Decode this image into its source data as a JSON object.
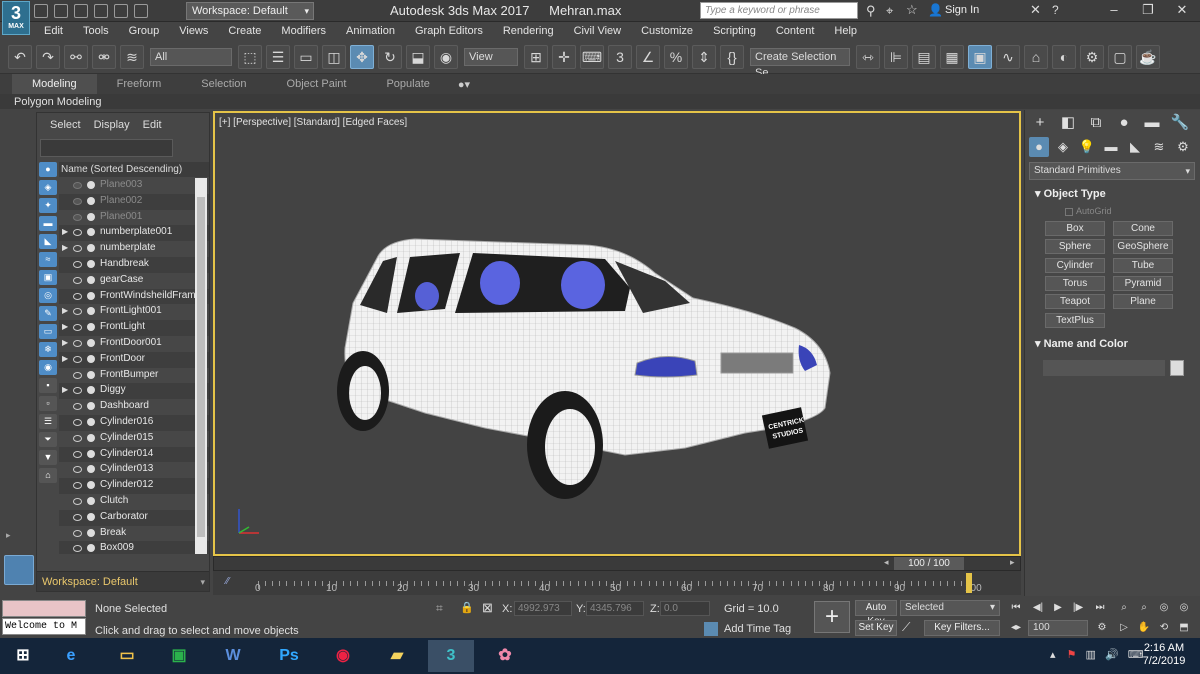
{
  "title_bar": {
    "workspace": "Workspace: Default",
    "app_title": "Autodesk 3ds Max 2017",
    "file_name": "Mehran.max",
    "search_placeholder": "Type a keyword or phrase",
    "sign_in": "Sign In"
  },
  "logo": {
    "main": "3",
    "sub": "MAX"
  },
  "menu": [
    "Edit",
    "Tools",
    "Group",
    "Views",
    "Create",
    "Modifiers",
    "Animation",
    "Graph Editors",
    "Rendering",
    "Civil View",
    "Customize",
    "Scripting",
    "Content",
    "Help"
  ],
  "toolbar": {
    "filter": "All",
    "ref_coord": "View",
    "selection_set": "Create Selection Se"
  },
  "ribbon": {
    "tabs": [
      "Modeling",
      "Freeform",
      "Selection",
      "Object Paint",
      "Populate"
    ],
    "active": "Modeling",
    "panel": "Polygon Modeling"
  },
  "scene_explorer": {
    "menu": [
      "Select",
      "Display",
      "Edit"
    ],
    "column_header": "Name (Sorted Descending)",
    "items": [
      {
        "name": "Plane003",
        "expandable": false,
        "frozen": true
      },
      {
        "name": "Plane002",
        "expandable": false,
        "frozen": true
      },
      {
        "name": "Plane001",
        "expandable": false,
        "frozen": true
      },
      {
        "name": "numberplate001",
        "expandable": true,
        "frozen": false
      },
      {
        "name": "numberplate",
        "expandable": true,
        "frozen": false
      },
      {
        "name": "Handbreak",
        "expandable": false,
        "frozen": false
      },
      {
        "name": "gearCase",
        "expandable": false,
        "frozen": false
      },
      {
        "name": "FrontWindsheildFrame",
        "expandable": false,
        "frozen": false
      },
      {
        "name": "FrontLight001",
        "expandable": true,
        "frozen": false
      },
      {
        "name": "FrontLight",
        "expandable": true,
        "frozen": false
      },
      {
        "name": "FrontDoor001",
        "expandable": true,
        "frozen": false
      },
      {
        "name": "FrontDoor",
        "expandable": true,
        "frozen": false
      },
      {
        "name": "FrontBumper",
        "expandable": false,
        "frozen": false
      },
      {
        "name": "Diggy",
        "expandable": true,
        "frozen": false
      },
      {
        "name": "Dashboard",
        "expandable": false,
        "frozen": false
      },
      {
        "name": "Cylinder016",
        "expandable": false,
        "frozen": false
      },
      {
        "name": "Cylinder015",
        "expandable": false,
        "frozen": false
      },
      {
        "name": "Cylinder014",
        "expandable": false,
        "frozen": false
      },
      {
        "name": "Cylinder013",
        "expandable": false,
        "frozen": false
      },
      {
        "name": "Cylinder012",
        "expandable": false,
        "frozen": false
      },
      {
        "name": "Clutch",
        "expandable": false,
        "frozen": false
      },
      {
        "name": "Carborator",
        "expandable": false,
        "frozen": false
      },
      {
        "name": "Break",
        "expandable": false,
        "frozen": false
      },
      {
        "name": "Box009",
        "expandable": false,
        "frozen": false
      }
    ],
    "workspace": "Workspace: Default"
  },
  "viewport": {
    "label": "[+] [Perspective] [Standard] [Edged Faces]",
    "plate_line1": "CENTRICK",
    "plate_line2": "STUDIOS"
  },
  "timeline": {
    "frame": "100 / 100",
    "ticks": [
      "0",
      "10",
      "20",
      "30",
      "40",
      "50",
      "60",
      "70",
      "80",
      "90",
      "100"
    ]
  },
  "command_panel": {
    "category_dropdown": "Standard Primitives",
    "object_type_title": "Object Type",
    "autogrid": "AutoGrid",
    "primitives": [
      "Box",
      "Cone",
      "Sphere",
      "GeoSphere",
      "Cylinder",
      "Tube",
      "Torus",
      "Pyramid",
      "Teapot",
      "Plane",
      "TextPlus"
    ],
    "name_color_title": "Name and Color"
  },
  "status": {
    "maxscript_prompt": "Welcome to M",
    "selection": "None Selected",
    "prompt": "Click and drag to select and move objects",
    "x_label": "X:",
    "x_value": "4992.973",
    "y_label": "Y:",
    "y_value": "4345.796",
    "z_label": "Z:",
    "z_value": "0.0",
    "grid": "Grid = 10.0",
    "add_time_tag": "Add Time Tag",
    "auto_key": "Auto Key",
    "set_key": "Set Key",
    "key_mode": "Selected",
    "key_filters": "Key Filters...",
    "frame_value": "100"
  },
  "taskbar": {
    "time": "2:16 AM",
    "date": "7/2/2019"
  },
  "colors": {
    "accent": "#5b8bb2",
    "viewport_border": "#e5c448",
    "taskbar": "#14253a"
  }
}
